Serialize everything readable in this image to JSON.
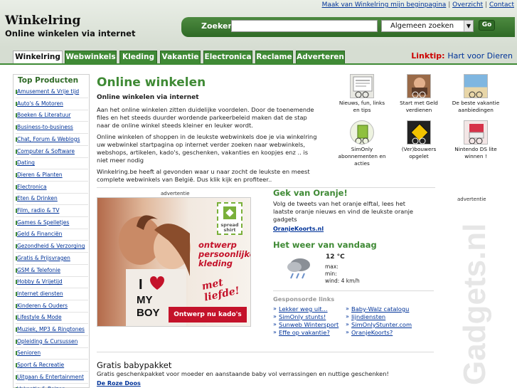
{
  "header": {
    "logo": "Winkelring",
    "tagline": "Online winkelen via internet",
    "toplinks": [
      "Maak van Winkelring mijn beginpagina",
      "Overzicht",
      "Contact"
    ],
    "separator": "|"
  },
  "search": {
    "label": "Zoeken:",
    "input_value": "",
    "select_value": "Algemeen zoeken",
    "button": "Go"
  },
  "tabs": [
    "Winkelring",
    "Webwinkels",
    "Kleding",
    "Vakantie",
    "Electronica",
    "Reclame",
    "Adverteren"
  ],
  "linktip": {
    "label": "Linktip:",
    "link": "Hart voor Dieren"
  },
  "sidebar": {
    "title": "Top Producten",
    "items": [
      "Amusement & Vrije tijd",
      "Auto's & Motoren",
      "Boeken & Literatuur",
      "Business-to-business",
      "Chat, Forum & Weblogs",
      "Computer & Software",
      "Dating",
      "Dieren & Planten",
      "Electronica",
      "Eten & Drinken",
      "Film, radio & TV",
      "Games & Spelletjes",
      "Geld & Financiën",
      "Gezondheid & Verzorging",
      "Gratis & Prijsvragen",
      "GSM & Telefonie",
      "Hobby & Vrijetijd",
      "Internet diensten",
      "Kinderen & Ouders",
      "Lifestyle & Mode",
      "Muziek, MP3 & Ringtones",
      "Opleiding & Cursussen",
      "Senioren",
      "Sport & Recreatie",
      "Uitgaan & Entertainment",
      "Vakantie & Reizen"
    ]
  },
  "main": {
    "title": "Online winkelen",
    "subtitle": "Online winkelen via internet",
    "paragraphs": [
      "Aan het online winkelen zitten duidelijke voordelen. Door de toenemende files en het steeds duurder wordende parkeerbeleid maken dat de stap naar de online winkel steeds kleiner en leuker wordt.",
      "Online winkelen of shoppen in de leukste webwinkels doe je via winkelring uw webwinkel startpagina op internet verder zoeken naar webwinkels, webshops, artikelen, kado's, geschenken, vakanties en koopjes enz .. is niet meer nodig",
      "Winkelring.be heeft al gevonden waar u naar zocht de leukste en meest complete webwinkels van België. Dus klik kijk en profiteer.."
    ]
  },
  "icons": [
    {
      "label": "Nieuws, fun, links en tips",
      "icon": "newspaper-icon"
    },
    {
      "label": "Start met Geld verdienen",
      "icon": "money-icon"
    },
    {
      "label": "De beste vakantie aanbiedingen",
      "icon": "beach-icon"
    },
    {
      "label": "SimOnly abonnementen en acties",
      "icon": "simcard-icon"
    },
    {
      "label": "(Ver)bouwers opgelet",
      "icon": "construction-icon"
    },
    {
      "label": "Nintendo DS lite winnen !",
      "icon": "nintendo-icon"
    }
  ],
  "ad": {
    "label": "advertentie",
    "brand": "spread shirt",
    "headline": "ontwerp persoonlijke kleding",
    "script": "met liefde!",
    "shirt_text": "I ♥ MY BOY",
    "cta": "Ontwerp nu kado's"
  },
  "oranje": {
    "title": "Gek van Oranje!",
    "text": "Volg de tweets van het oranje elftal, lees het laatste oranje nieuws en vind de leukste oranje gadgets",
    "link": "OranjeKoorts.nl"
  },
  "weather": {
    "title": "Het weer van vandaag",
    "temp": "12 °C",
    "max_label": "max:",
    "min_label": "min:",
    "wind": "wind: 4 km/h"
  },
  "sponsored": {
    "title": "Gesponsorde links",
    "left": [
      "Lekker weg uit...",
      "SimOnly stunts!",
      "Sunweb Wintersport",
      "Effe op vakantie?"
    ],
    "right": [
      "Baby-Walz catalogu",
      "Iijndiensten",
      "SimOnlyStunter.com",
      "OranjeKoorts?"
    ],
    "bullet": "»"
  },
  "baby": {
    "title": "Gratis babypakket",
    "text": "Gratis geschenkpakket voor moeder en aanstaande baby vol verrassingen en nuttige geschenken!",
    "link": "De Roze Doos"
  },
  "right_ad": {
    "label": "advertentie",
    "watermark": "Gadgets.nl"
  },
  "colors": {
    "accent": "#3f8a35",
    "link": "#003399",
    "cta": "#c4122a"
  }
}
